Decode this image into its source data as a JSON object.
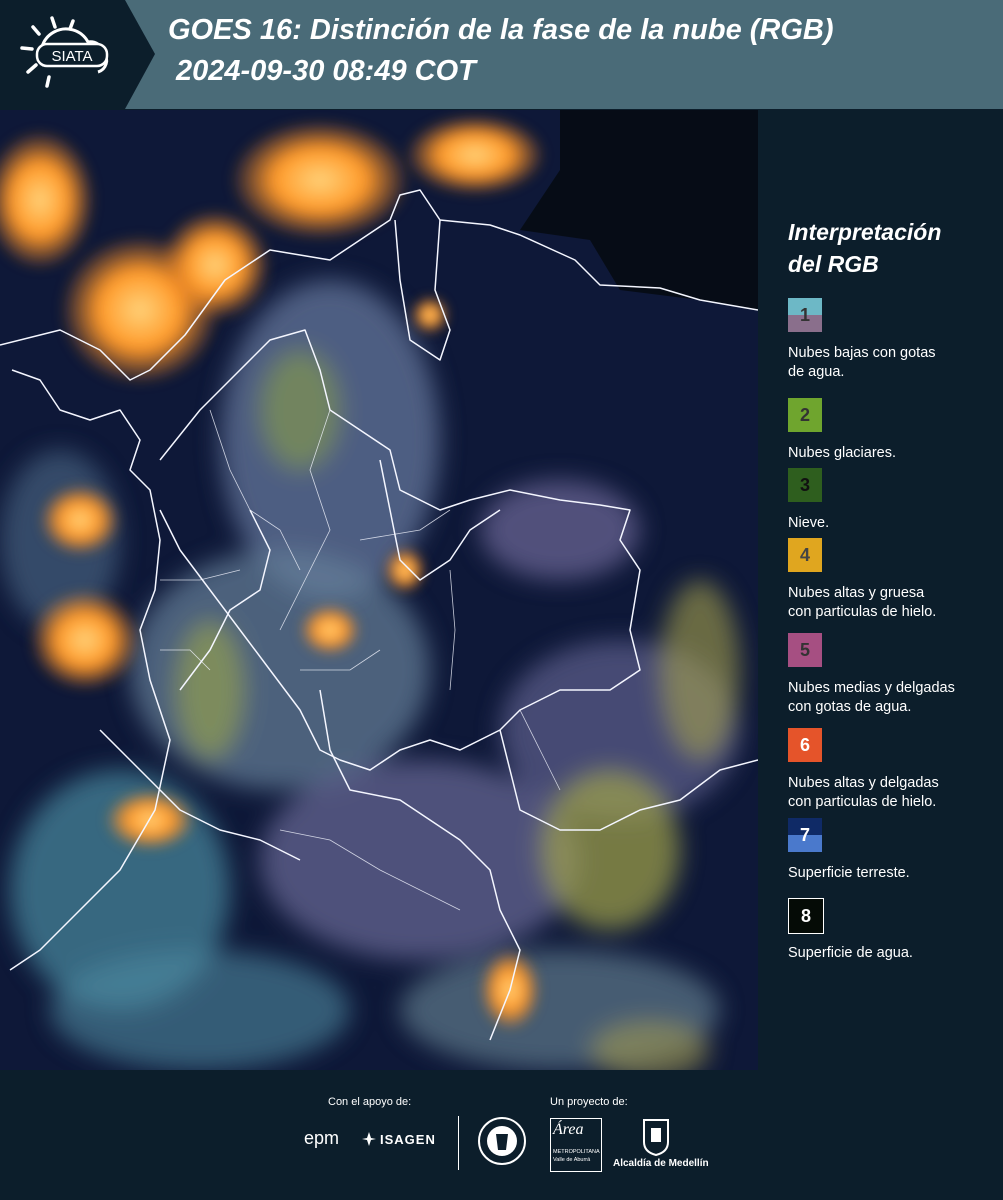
{
  "header": {
    "logo_text": "SIATA",
    "title": "GOES 16: Distinción de la fase de la nube (RGB)",
    "timestamp": "2024-09-30 08:49 COT"
  },
  "legend": {
    "title_line1": "Interpretación",
    "title_line2": "del RGB",
    "items": [
      {
        "number": "1",
        "label_line1": "Nubes bajas con gotas",
        "label_line2": "de agua.",
        "color_top": "#6db8c6",
        "color_bottom": "#8a6f8c",
        "number_color": "#333333"
      },
      {
        "number": "2",
        "label_line1": "Nubes glaciares.",
        "label_line2": "",
        "color_top": "#6fa52e",
        "color_bottom": "#6fa52e",
        "number_color": "#333333"
      },
      {
        "number": "3",
        "label_line1": "Nieve.",
        "label_line2": "",
        "color_top": "#2e5e1e",
        "color_bottom": "#2e5e1e",
        "number_color": "#111111"
      },
      {
        "number": "4",
        "label_line1": "Nubes altas y gruesa",
        "label_line2": "con particulas de hielo.",
        "color_top": "#e0a61f",
        "color_bottom": "#e0a61f",
        "number_color": "#444444"
      },
      {
        "number": "5",
        "label_line1": "Nubes medias y delgadas",
        "label_line2": "con gotas de agua.",
        "color_top": "#a64f82",
        "color_bottom": "#a64f82",
        "number_color": "#333333"
      },
      {
        "number": "6",
        "label_line1": "Nubes altas y delgadas",
        "label_line2": "con particulas de hielo.",
        "color_top": "#e5542a",
        "color_bottom": "#e5542a",
        "number_color": "#ffffff"
      },
      {
        "number": "7",
        "label_line1": "Superficie terreste.",
        "label_line2": "",
        "color_top": "#0f2a66",
        "color_bottom": "#4a79cc",
        "number_color": "#ffffff"
      },
      {
        "number": "8",
        "label_line1": "Superficie de agua.",
        "label_line2": "",
        "color_top": "#050b06",
        "color_bottom": "#050b06",
        "number_color": "#ffffff"
      }
    ]
  },
  "footer": {
    "support_label": "Con el apoyo de:",
    "project_label": "Un proyecto de:",
    "epm_text": "epm",
    "isagen_text": "ISAGEN",
    "area_text": "Área",
    "area_sub1": "METROPOLITANA",
    "area_sub2": "Valle de Aburrá",
    "alcaldia_text": "Alcaldía de Medellín"
  }
}
